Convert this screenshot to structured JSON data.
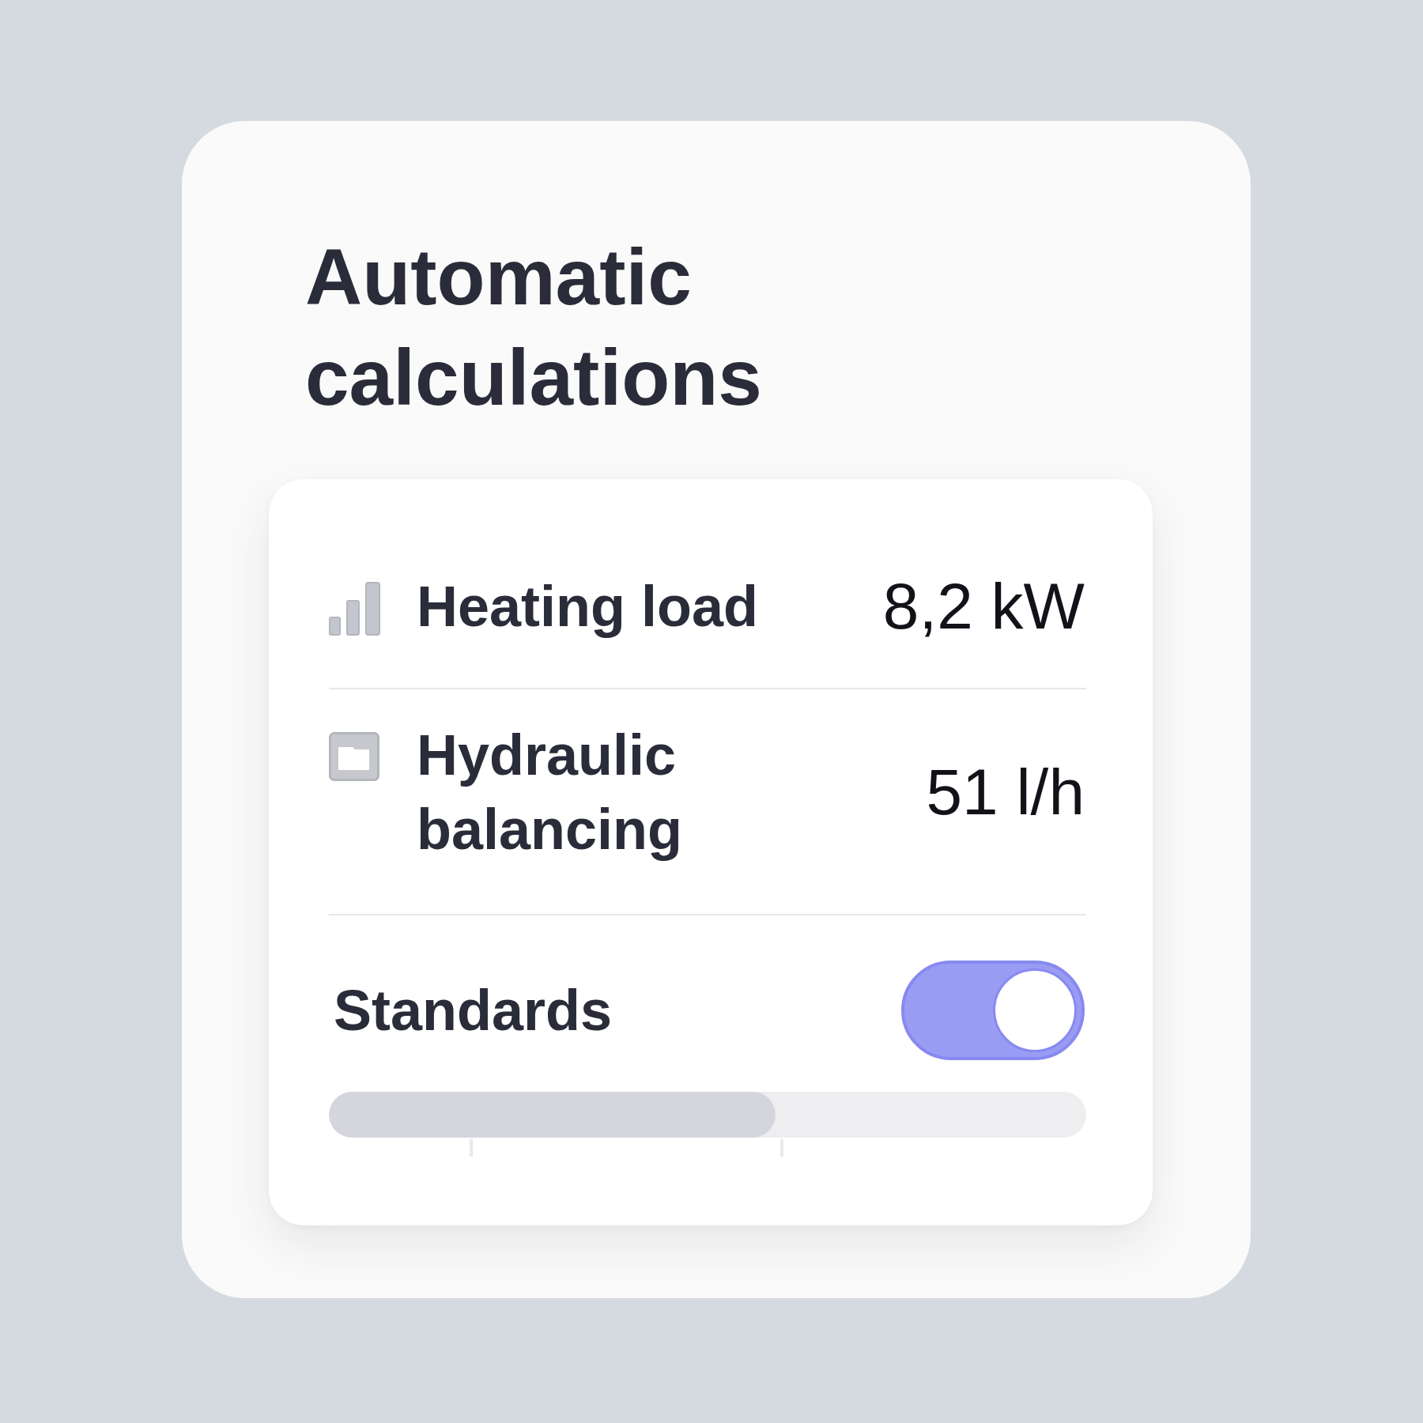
{
  "card": {
    "title": "Automatic calculations"
  },
  "metrics": [
    {
      "label": "Heating load",
      "value": "8,2 kW"
    },
    {
      "label": "Hydraulic balancing",
      "value": "51 l/h"
    }
  ],
  "standards": {
    "label": "Standards",
    "on": true,
    "level": 0.59
  }
}
